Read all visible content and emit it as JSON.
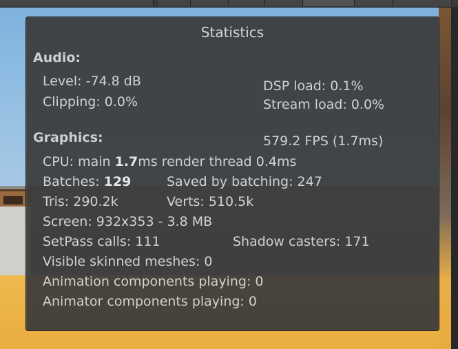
{
  "panel": {
    "title": "Statistics",
    "audio": {
      "header": "Audio:",
      "level": "Level: -74.8 dB",
      "clipping": "Clipping: 0.0%",
      "dsp_load": "DSP load: 0.1%",
      "stream_load": "Stream load: 0.0%"
    },
    "graphics": {
      "header": "Graphics:",
      "fps": "579.2 FPS (1.7ms)",
      "cpu_prefix": "CPU: main ",
      "cpu_main": "1.7",
      "cpu_suffix": "ms  render thread 0.4ms",
      "batches_prefix": "Batches: ",
      "batches_value": "129",
      "saved_by_batching": "Saved by batching: 247",
      "tris": "Tris: 290.2k",
      "verts": "Verts: 510.5k",
      "screen": "Screen: 932x353 - 3.8 MB",
      "setpass_calls": "SetPass calls: 111",
      "shadow_casters": "Shadow casters: 171",
      "visible_skinned_meshes": "Visible skinned meshes: 0",
      "animation_components": "Animation components playing: 0",
      "animator_components": "Animator components playing: 0"
    }
  },
  "colors": {
    "panel_bg": "#3a3a3a",
    "text": "#d2d2d2",
    "sky": "#8fbde2",
    "sand": "#eeb44a"
  }
}
